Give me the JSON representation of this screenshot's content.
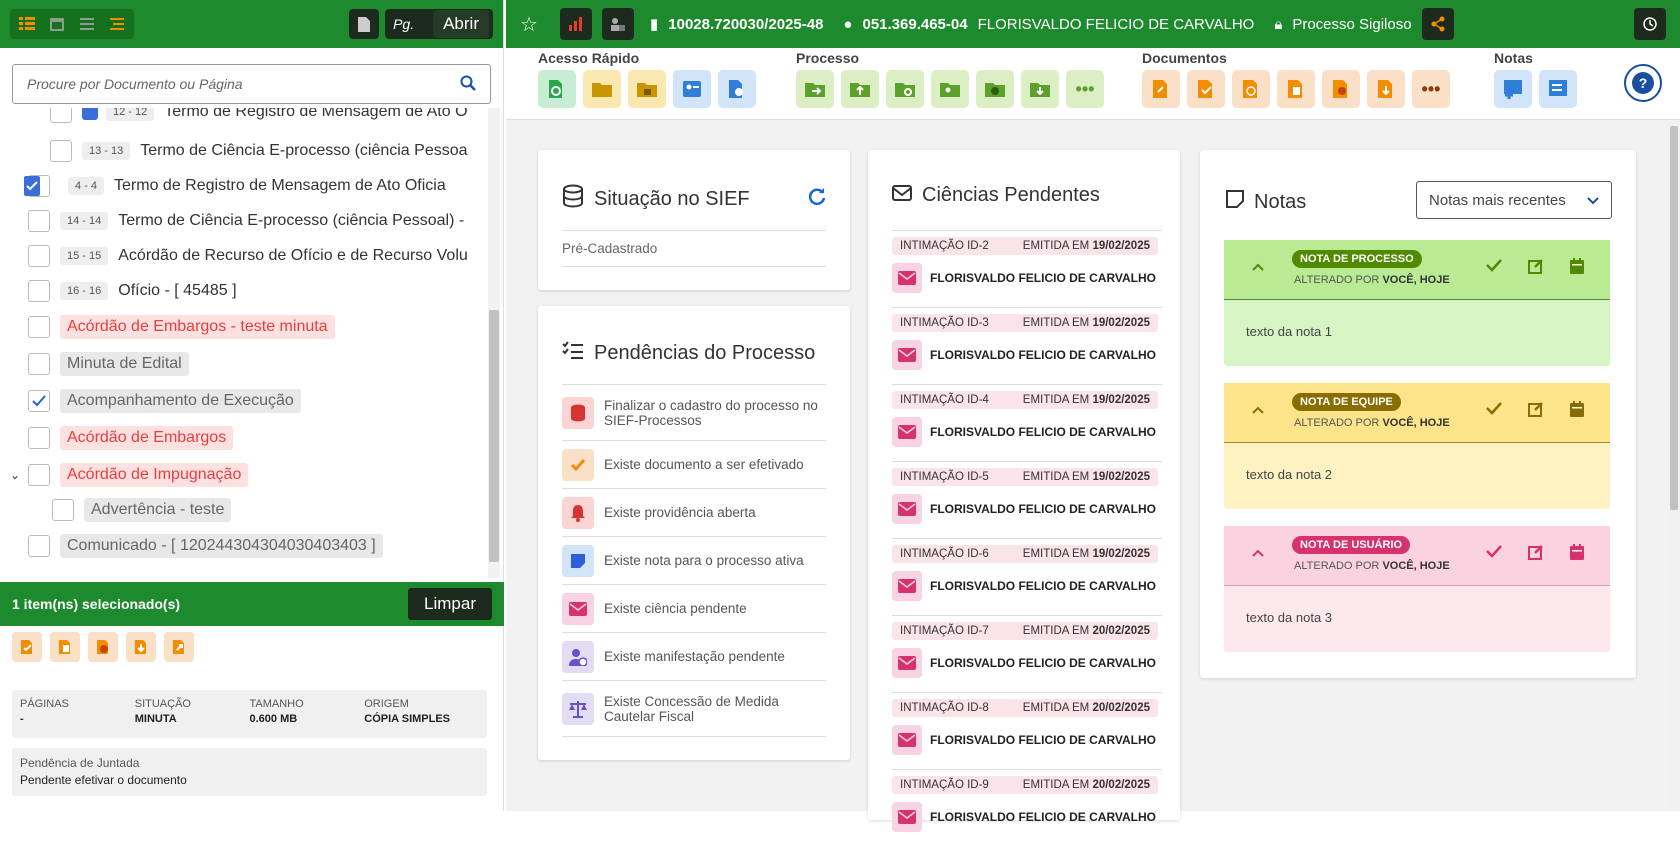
{
  "left": {
    "pg_label": "Pg.",
    "open_label": "Abrir",
    "search_placeholder": "Procure por Documento ou Página",
    "tree": [
      {
        "range": "13 - 13",
        "title": "Termo de Ciência E-processo (ciência Pessoa"
      },
      {
        "range": "4 - 4",
        "title": "Termo de Registro de Mensagem de Ato Oficia"
      },
      {
        "range": "14 - 14",
        "title": "Termo de Ciência E-processo (ciência Pessoal) -"
      },
      {
        "range": "15 - 15",
        "title": "Acórdão de Recurso de Ofício e de Recurso Volu"
      },
      {
        "range": "16 - 16",
        "title": "Ofício - [ 45485 ]"
      },
      {
        "title": "Acórdão de Embargos - teste minuta"
      },
      {
        "title": "Minuta de Edital"
      },
      {
        "title": "Acompanhamento de Execução"
      },
      {
        "title": "Acórdão de Embargos"
      },
      {
        "title": "Acórdão de Impugnação"
      },
      {
        "title": "Advertência - teste"
      },
      {
        "title": "Comunicado - [ 120244304304030403403 ]"
      }
    ],
    "partial_row": "Termo de Registro de Mensagem de Ato O",
    "partial_range": "12 - 12",
    "selection_text": "1 item(ns) selecionado(s)",
    "clear_label": "Limpar",
    "meta": [
      {
        "k": "PÁGINAS",
        "v": "-"
      },
      {
        "k": "SITUAÇÃO",
        "v": "MINUTA"
      },
      {
        "k": "TAMANHO",
        "v": "0.600 MB"
      },
      {
        "k": "ORIGEM",
        "v": "CÓPIA SIMPLES"
      }
    ],
    "pend_label": "Pendência de Juntada",
    "pend_value": "Pendente efetivar o documento"
  },
  "header": {
    "process_number": "10028.720030/2025-48",
    "cpf": "051.369.465-04",
    "person": "FLORISVALDO FELICIO DE CARVALHO",
    "secret": "Processo Sigiloso"
  },
  "toolbar": {
    "quick": "Acesso Rápido",
    "process": "Processo",
    "docs": "Documentos",
    "notes": "Notas"
  },
  "sief": {
    "title": "Situação no SIEF",
    "status": "Pré-Cadastrado"
  },
  "pendencias": {
    "title": "Pendências do Processo",
    "items": [
      "Finalizar o cadastro do processo no SIEF-Processos",
      "Existe documento a ser efetivado",
      "Existe providência aberta",
      "Existe nota para o processo ativa",
      "Existe ciência pendente",
      "Existe manifestação pendente",
      "Existe Concessão de Medida Cautelar Fiscal"
    ]
  },
  "ciencias": {
    "title": "Ciências Pendentes",
    "items": [
      {
        "id": "INTIMAÇÃO ID-2",
        "date": "19/02/2025"
      },
      {
        "id": "INTIMAÇÃO ID-3",
        "date": "19/02/2025"
      },
      {
        "id": "INTIMAÇÃO ID-4",
        "date": "19/02/2025"
      },
      {
        "id": "INTIMAÇÃO ID-5",
        "date": "19/02/2025"
      },
      {
        "id": "INTIMAÇÃO ID-6",
        "date": "19/02/2025"
      },
      {
        "id": "INTIMAÇÃO ID-7",
        "date": "20/02/2025"
      },
      {
        "id": "INTIMAÇÃO ID-8",
        "date": "20/02/2025"
      },
      {
        "id": "INTIMAÇÃO ID-9",
        "date": "20/02/2025"
      }
    ],
    "emitted": "EMITIDA EM",
    "person": "FLORISVALDO FELICIO DE CARVALHO"
  },
  "notas": {
    "title": "Notas",
    "sort": "Notas mais recentes",
    "altered": "ALTERADO POR",
    "who": "VOCÊ, HOJE",
    "items": [
      {
        "badge": "NOTA DE PROCESSO",
        "text": "texto da nota 1",
        "color": "#4f8a00"
      },
      {
        "badge": "NOTA DE EQUIPE",
        "text": "texto da nota 2",
        "color": "#8a6d00"
      },
      {
        "badge": "NOTA DE USUÁRIO",
        "text": "texto da nota 3",
        "color": "#d6336c"
      }
    ]
  }
}
